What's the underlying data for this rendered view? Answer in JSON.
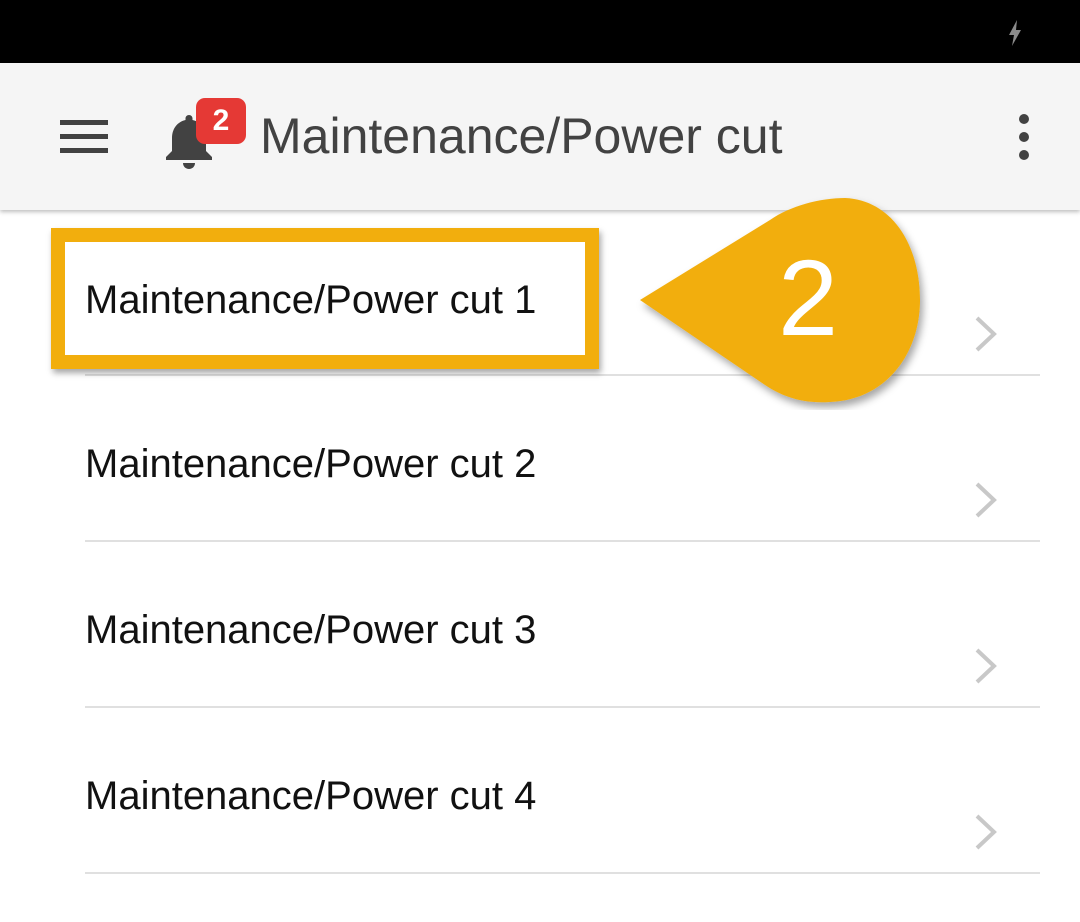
{
  "status_bar": {
    "icons": [
      "charging-icon"
    ],
    "background": "#000000"
  },
  "app_bar": {
    "menu_icon": "hamburger-menu-icon",
    "notification": {
      "icon": "bell-icon",
      "badge_count": "2",
      "badge_color": "#e53935"
    },
    "title": "Maintenance/Power cut",
    "overflow_icon": "more-vert-icon"
  },
  "list": {
    "items": [
      {
        "label": "Maintenance/Power cut 1"
      },
      {
        "label": "Maintenance/Power cut 2"
      },
      {
        "label": "Maintenance/Power cut 3"
      },
      {
        "label": "Maintenance/Power cut 4"
      }
    ],
    "chevron_icon": "chevron-right-icon"
  },
  "annotation": {
    "step_number": "2",
    "color": "#f2ae0d",
    "highlighted_item": "Maintenance/Power cut 1"
  }
}
